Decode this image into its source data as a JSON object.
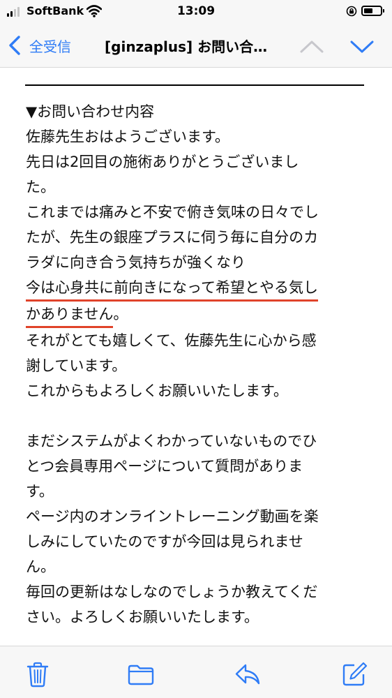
{
  "status_bar": {
    "carrier": "SoftBank",
    "time": "13:09"
  },
  "nav": {
    "back_label": "全受信",
    "title": "[ginzaplus] お問い合…"
  },
  "message": {
    "lines": [
      "▼お問い合わせ内容",
      "佐藤先生おはようございます。",
      "先日は2回目の施術ありがとうございまし",
      "た。",
      "これまでは痛みと不安で俯き気味の日々でし",
      "たが、先生の銀座プラスに伺う毎に自分のカ",
      "ラダに向き合う気持ちが強くなり",
      "今は心身共に前向きになって希望とやる気し",
      "かありません",
      "。",
      "それがとても嬉しくて、佐藤先生に心から感",
      "謝しています。",
      "これからもよろしくお願いいたします。",
      "まだシステムがよくわかっていないものでひ",
      "とつ会員専用ページについて質問がありま",
      "す。",
      "ページ内のオンライントレーニング動画を楽",
      "しみにしていたのですが今回は見られませ",
      "ん。",
      "毎回の更新はなしなのでしょうか教えてくだ",
      "さい。よろしくお願いいたします。"
    ]
  },
  "icons": {
    "trash": "trash-icon",
    "folder": "folder-icon",
    "reply": "reply-icon",
    "compose": "compose-icon"
  },
  "colors": {
    "accent": "#2f7cf6",
    "highlight_underline": "#e0432a"
  }
}
